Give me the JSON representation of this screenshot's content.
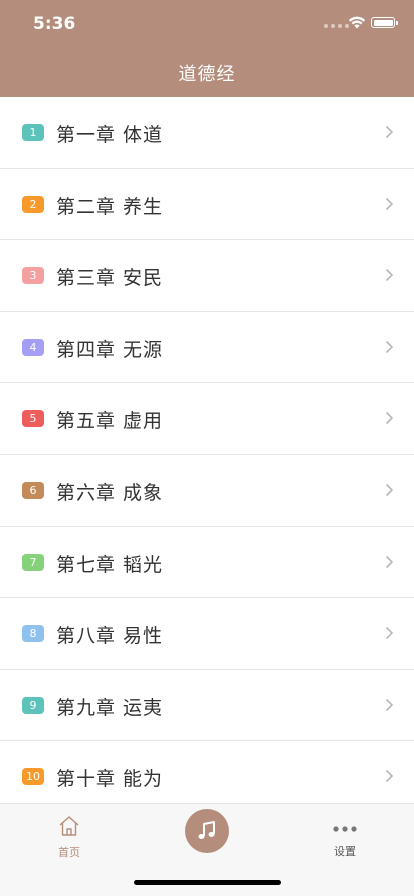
{
  "status": {
    "time": "5:36"
  },
  "nav": {
    "title": "道德经"
  },
  "chapters": [
    {
      "num": "1",
      "label": "第一章 体道",
      "color": "#5cc3bb"
    },
    {
      "num": "2",
      "label": "第二章 养生",
      "color": "#f79a2b"
    },
    {
      "num": "3",
      "label": "第三章 安民",
      "color": "#f5a0a0"
    },
    {
      "num": "4",
      "label": "第四章 无源",
      "color": "#a59ef5"
    },
    {
      "num": "5",
      "label": "第五章 虚用",
      "color": "#ef5c5c"
    },
    {
      "num": "6",
      "label": "第六章 成象",
      "color": "#c48b5a"
    },
    {
      "num": "7",
      "label": "第七章 韬光",
      "color": "#86d27a"
    },
    {
      "num": "8",
      "label": "第八章 易性",
      "color": "#8ec1ee"
    },
    {
      "num": "9",
      "label": "第九章 运夷",
      "color": "#5cc3bb"
    },
    {
      "num": "10",
      "label": "第十章 能为",
      "color": "#f79a2b"
    }
  ],
  "tabbar": {
    "home_label": "首页",
    "settings_label": "设置",
    "accent": "#b48d7c"
  },
  "icons": {
    "home": "home-icon",
    "music": "music-note-icon",
    "more": "more-dots-icon",
    "chevron": "chevron-right-icon"
  }
}
